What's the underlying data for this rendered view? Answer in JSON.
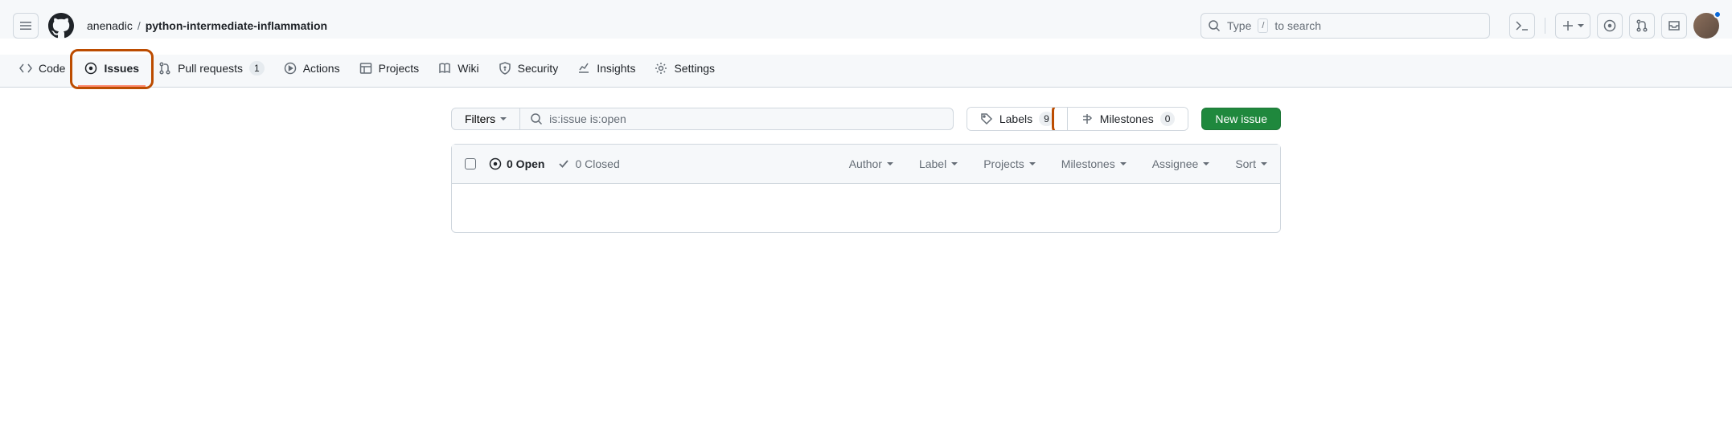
{
  "breadcrumb": {
    "owner": "anenadic",
    "repo": "python-intermediate-inflammation",
    "sep": "/"
  },
  "search": {
    "placeholder_pre": "Type",
    "slash": "/",
    "placeholder_post": "to search"
  },
  "nav": {
    "code": "Code",
    "issues": "Issues",
    "pulls": "Pull requests",
    "pulls_count": "1",
    "actions": "Actions",
    "projects": "Projects",
    "wiki": "Wiki",
    "security": "Security",
    "insights": "Insights",
    "settings": "Settings"
  },
  "toolbar": {
    "filters": "Filters",
    "query": "is:issue is:open",
    "labels": "Labels",
    "labels_count": "9",
    "milestones": "Milestones",
    "milestones_count": "0",
    "new_issue": "New issue"
  },
  "list": {
    "open": "0 Open",
    "closed": "0 Closed",
    "author": "Author",
    "label": "Label",
    "projects": "Projects",
    "milestones": "Milestones",
    "assignee": "Assignee",
    "sort": "Sort"
  }
}
